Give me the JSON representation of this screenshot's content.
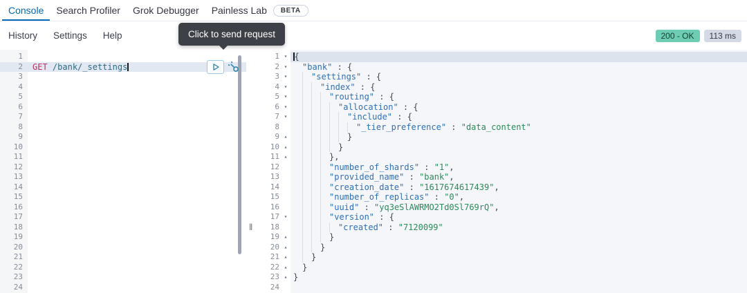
{
  "tabs": [
    {
      "label": "Console",
      "active": true
    },
    {
      "label": "Search Profiler",
      "active": false
    },
    {
      "label": "Grok Debugger",
      "active": false
    },
    {
      "label": "Painless Lab",
      "active": false,
      "badge": "BETA"
    }
  ],
  "toolbar": {
    "items": [
      "History",
      "Settings",
      "Help"
    ]
  },
  "status": {
    "code": "200 - OK",
    "time": "113 ms"
  },
  "tooltip": "Click to send request",
  "request_editor": {
    "line_count": 24,
    "active_line": 2,
    "request": {
      "method": "GET",
      "url": "/bank/_settings"
    }
  },
  "response_editor": {
    "line_count": 24,
    "active_line": 1,
    "lines": [
      {
        "n": 1,
        "d": 0,
        "fold": "open",
        "cursor": true,
        "t": [
          [
            "p",
            "{"
          ]
        ]
      },
      {
        "n": 2,
        "d": 1,
        "fold": "open",
        "t": [
          [
            "k",
            "\"bank\""
          ],
          [
            "p",
            " : {"
          ]
        ]
      },
      {
        "n": 3,
        "d": 2,
        "fold": "open",
        "t": [
          [
            "k",
            "\"settings\""
          ],
          [
            "p",
            " : {"
          ]
        ]
      },
      {
        "n": 4,
        "d": 3,
        "fold": "open",
        "t": [
          [
            "k",
            "\"index\""
          ],
          [
            "p",
            " : {"
          ]
        ]
      },
      {
        "n": 5,
        "d": 4,
        "fold": "open",
        "t": [
          [
            "k",
            "\"routing\""
          ],
          [
            "p",
            " : {"
          ]
        ]
      },
      {
        "n": 6,
        "d": 5,
        "fold": "open",
        "t": [
          [
            "k",
            "\"allocation\""
          ],
          [
            "p",
            " : {"
          ]
        ]
      },
      {
        "n": 7,
        "d": 6,
        "fold": "open",
        "t": [
          [
            "k",
            "\"include\""
          ],
          [
            "p",
            " : {"
          ]
        ]
      },
      {
        "n": 8,
        "d": 7,
        "t": [
          [
            "k",
            "\"_tier_preference\""
          ],
          [
            "p",
            " : "
          ],
          [
            "s",
            "\"data_content\""
          ]
        ]
      },
      {
        "n": 9,
        "d": 6,
        "fold": "close",
        "t": [
          [
            "p",
            "}"
          ]
        ]
      },
      {
        "n": 10,
        "d": 5,
        "fold": "close",
        "t": [
          [
            "p",
            "}"
          ]
        ]
      },
      {
        "n": 11,
        "d": 4,
        "fold": "close",
        "t": [
          [
            "p",
            "},"
          ]
        ]
      },
      {
        "n": 12,
        "d": 4,
        "t": [
          [
            "k",
            "\"number_of_shards\""
          ],
          [
            "p",
            " : "
          ],
          [
            "s",
            "\"1\""
          ],
          [
            "p",
            ","
          ]
        ]
      },
      {
        "n": 13,
        "d": 4,
        "t": [
          [
            "k",
            "\"provided_name\""
          ],
          [
            "p",
            " : "
          ],
          [
            "s",
            "\"bank\""
          ],
          [
            "p",
            ","
          ]
        ]
      },
      {
        "n": 14,
        "d": 4,
        "t": [
          [
            "k",
            "\"creation_date\""
          ],
          [
            "p",
            " : "
          ],
          [
            "s",
            "\"1617674617439\""
          ],
          [
            "p",
            ","
          ]
        ]
      },
      {
        "n": 15,
        "d": 4,
        "t": [
          [
            "k",
            "\"number_of_replicas\""
          ],
          [
            "p",
            " : "
          ],
          [
            "s",
            "\"0\""
          ],
          [
            "p",
            ","
          ]
        ]
      },
      {
        "n": 16,
        "d": 4,
        "t": [
          [
            "k",
            "\"uuid\""
          ],
          [
            "p",
            " : "
          ],
          [
            "s",
            "\"yq3eSlAWRMO2Td0Sl769rQ\""
          ],
          [
            "p",
            ","
          ]
        ]
      },
      {
        "n": 17,
        "d": 4,
        "fold": "open",
        "t": [
          [
            "k",
            "\"version\""
          ],
          [
            "p",
            " : {"
          ]
        ]
      },
      {
        "n": 18,
        "d": 5,
        "t": [
          [
            "k",
            "\"created\""
          ],
          [
            "p",
            " : "
          ],
          [
            "s",
            "\"7120099\""
          ]
        ]
      },
      {
        "n": 19,
        "d": 4,
        "fold": "close",
        "t": [
          [
            "p",
            "}"
          ]
        ]
      },
      {
        "n": 20,
        "d": 3,
        "fold": "close",
        "t": [
          [
            "p",
            "}"
          ]
        ]
      },
      {
        "n": 21,
        "d": 2,
        "fold": "close",
        "t": [
          [
            "p",
            "}"
          ]
        ]
      },
      {
        "n": 22,
        "d": 1,
        "fold": "close",
        "t": [
          [
            "p",
            "}"
          ]
        ]
      },
      {
        "n": 23,
        "d": 0,
        "fold": "close",
        "t": [
          [
            "p",
            "}"
          ]
        ]
      },
      {
        "n": 24,
        "d": 0,
        "t": []
      }
    ]
  },
  "icons": {
    "send": "play-triangle",
    "settings": "wrench"
  },
  "colors": {
    "accent": "#006BB4",
    "success_badge": "#6DCCB1",
    "default_badge": "#D3DAE6",
    "method": "#B5315F",
    "url": "#2D6A85",
    "json_key": "#2E6FB7",
    "json_string": "#2B8A5A",
    "tooltip_bg": "#3D4046",
    "active_line": "#E2E8F1"
  }
}
